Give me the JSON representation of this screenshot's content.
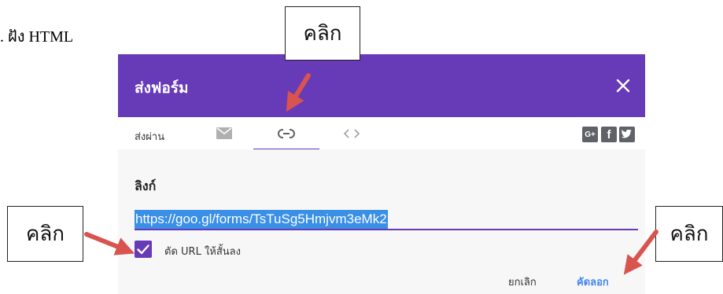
{
  "document": {
    "text": ". ฝัง HTML"
  },
  "callouts": {
    "top": "คลิก",
    "left": "คลิก",
    "right": "คลิก"
  },
  "dialog": {
    "title": "ส่งฟอร์ม",
    "send_via_label": "ส่งผ่าน",
    "tabs": [
      {
        "icon": "email-icon",
        "selected": false
      },
      {
        "icon": "link-icon",
        "selected": true
      },
      {
        "icon": "embed-code-icon",
        "selected": false
      }
    ],
    "social": [
      "google-plus-icon",
      "facebook-icon",
      "twitter-icon"
    ],
    "link_section_title": "ลิงก์",
    "link_value": "https://goo.gl/forms/TsTuSg5Hmjvm3eMk2",
    "shorten_url_label": "ตัด URL ให้สั้นลง",
    "shorten_url_checked": true,
    "cancel_label": "ยกเลิก",
    "copy_label": "คัดลอก"
  },
  "colors": {
    "header": "#673ab7",
    "copy_button": "#4285f4",
    "selection": "#3a8fe6",
    "arrow": "#d9534f"
  }
}
